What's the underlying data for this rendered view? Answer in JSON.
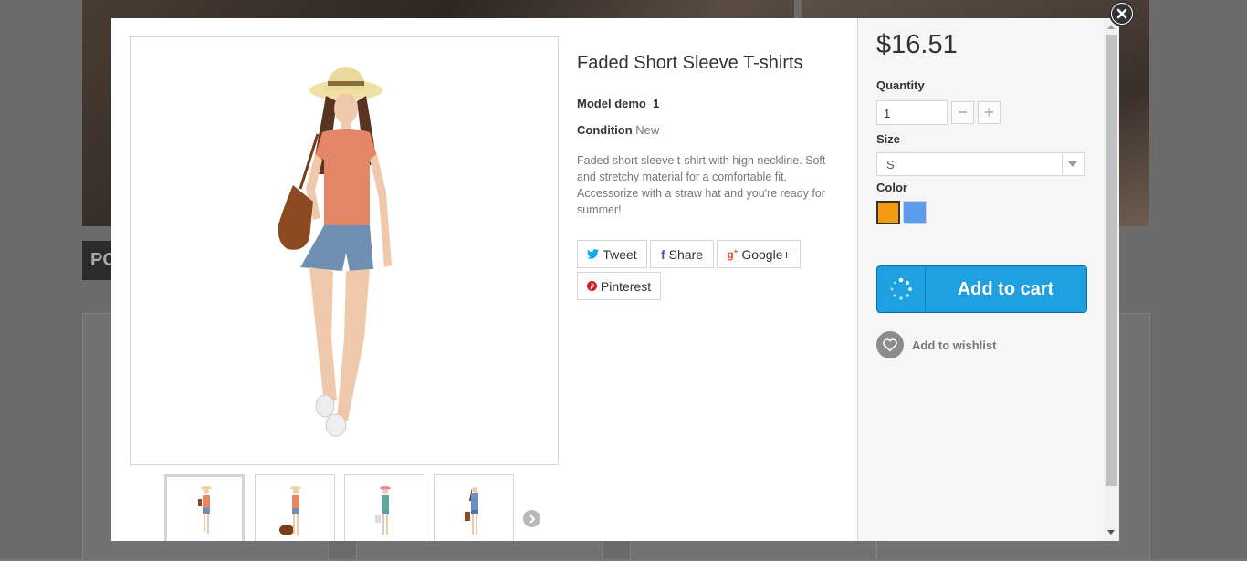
{
  "product": {
    "title": "Faded Short Sleeve T-shirts",
    "model_label": "Model",
    "model_value": "demo_1",
    "condition_label": "Condition",
    "condition_value": "New",
    "description": "Faded short sleeve t-shirt with high neckline. Soft and stretchy material for a comfortable fit. Accessorize with a straw hat and you're ready for summer!"
  },
  "share": {
    "tweet": "Tweet",
    "share": "Share",
    "google": "Google+",
    "pinterest": "Pinterest"
  },
  "buy": {
    "price": "$16.51",
    "quantity_label": "Quantity",
    "quantity_value": "1",
    "size_label": "Size",
    "size_value": "S",
    "color_label": "Color",
    "colors": [
      "#f39c11",
      "#5d9cec"
    ],
    "add_to_cart": "Add to cart",
    "add_to_wishlist": "Add to wishlist"
  },
  "background": {
    "tab_text": "PO"
  }
}
